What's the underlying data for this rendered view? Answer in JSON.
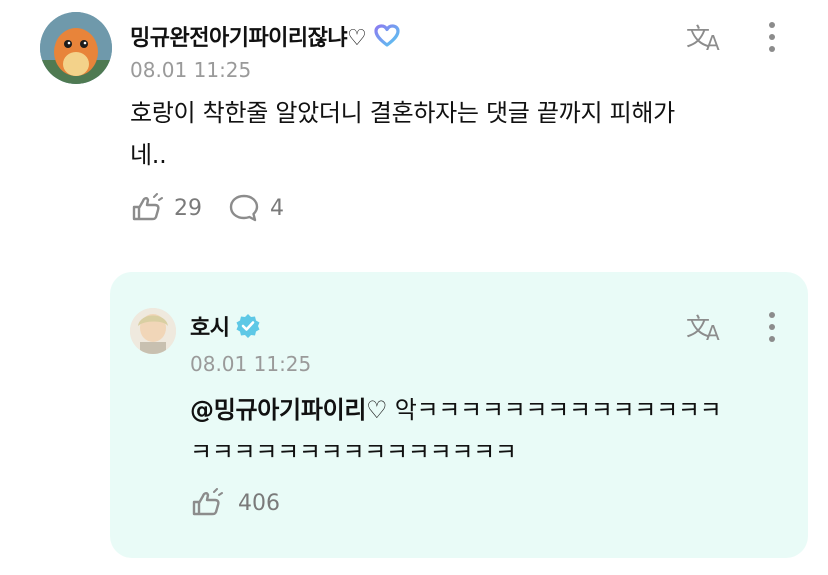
{
  "comment": {
    "author": "밍규완전아기파이리잖냐♡",
    "timestamp": "08.01 11:25",
    "text_line1": "호랑이 착한줄 알았더니 결혼하자는 댓글 끝까지 피해가",
    "text_line2": "네..",
    "likes": "29",
    "replies": "4"
  },
  "reply": {
    "author": "호시",
    "timestamp": "08.01 11:25",
    "mention": "@밍규아기파이리♡",
    "text_line1_rest": " 악ㅋㅋㅋㅋㅋㅋㅋㅋㅋㅋㅋㅋㅋㅋ",
    "text_line2": "ㅋㅋㅋㅋㅋㅋㅋㅋㅋㅋㅋㅋㅋㅋㅋ",
    "likes": "406"
  },
  "colors": {
    "reply_background": "#e9fbf7",
    "verified_badge": "#5ec8e6",
    "membership_badge_from": "#8a7cf0",
    "membership_badge_to": "#59c7f0"
  },
  "icons": [
    "translate-icon",
    "more-vertical-icon",
    "like-icon",
    "comment-icon",
    "verified-badge-icon",
    "membership-badge-icon"
  ]
}
